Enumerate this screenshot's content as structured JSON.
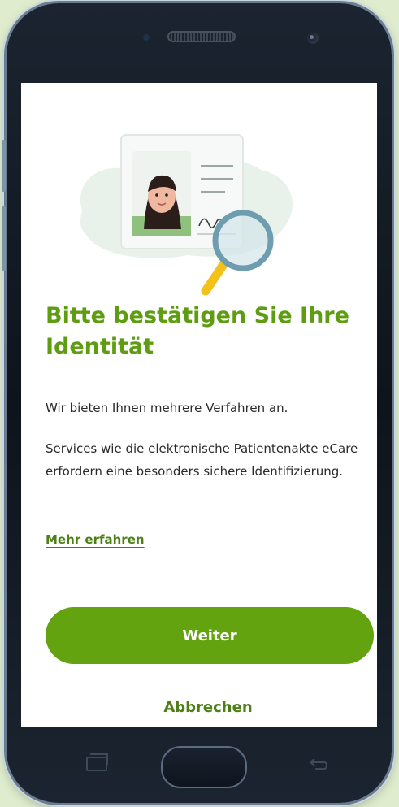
{
  "screen": {
    "title": "Bitte bestätigen Sie Ihre Identität",
    "paragraph1": "Wir bieten Ihnen mehrere Verfahren an.",
    "paragraph2": "Services wie die elektronische Patientenakte eCare erfordern eine besonders sichere Identifizierung.",
    "link_label": "Mehr erfahren",
    "primary_button": "Weiter",
    "secondary_button": "Abbrechen"
  },
  "illustration": {
    "icon": "id-card-with-magnifier-illustration"
  },
  "device_nav": {
    "recent_icon": "recent-apps-icon",
    "home_icon": "home-button",
    "back_icon": "back-icon"
  },
  "colors": {
    "accent": "#5e9c12",
    "button": "#62a30f",
    "link": "#4d7f16",
    "background": "#dfeccd"
  }
}
